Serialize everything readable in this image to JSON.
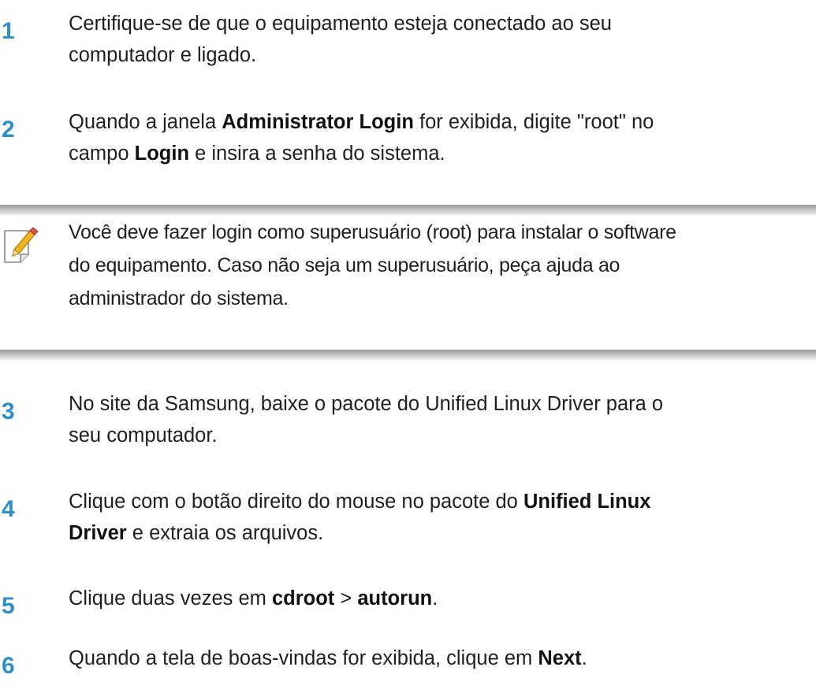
{
  "steps": [
    {
      "number": "1",
      "lines": [
        [
          {
            "text": "Certifique-se de que o equipamento esteja conectado ao seu",
            "bold": false
          }
        ],
        [
          {
            "text": "computador e ligado.",
            "bold": false
          }
        ]
      ]
    },
    {
      "number": "2",
      "lines": [
        [
          {
            "text": "Quando a janela ",
            "bold": false
          },
          {
            "text": "Administrator Login",
            "bold": true
          },
          {
            "text": " for exibida, digite \"root\" no",
            "bold": false
          }
        ],
        [
          {
            "text": "campo ",
            "bold": false
          },
          {
            "text": "Login",
            "bold": true
          },
          {
            "text": " e insira a senha do sistema.",
            "bold": false
          }
        ]
      ]
    },
    {
      "number": "3",
      "lines": [
        [
          {
            "text": "No site da Samsung, baixe o pacote do Unified Linux Driver para o",
            "bold": false
          }
        ],
        [
          {
            "text": "seu computador.",
            "bold": false
          }
        ]
      ]
    },
    {
      "number": "4",
      "lines": [
        [
          {
            "text": "Clique com o botão direito do mouse no pacote do ",
            "bold": false
          },
          {
            "text": "Unified Linux",
            "bold": true
          }
        ],
        [
          {
            "text": "Driver",
            "bold": true
          },
          {
            "text": " e extraia os arquivos.",
            "bold": false
          }
        ]
      ]
    },
    {
      "number": "5",
      "lines": [
        [
          {
            "text": "Clique duas vezes em ",
            "bold": false
          },
          {
            "text": "cdroot",
            "bold": true
          },
          {
            "text": " > ",
            "bold": false
          },
          {
            "text": "autorun",
            "bold": true
          },
          {
            "text": ".",
            "bold": false
          }
        ]
      ]
    },
    {
      "number": "6",
      "lines": [
        [
          {
            "text": "Quando a tela de boas-vindas for exibida, clique em ",
            "bold": false
          },
          {
            "text": "Next",
            "bold": true
          },
          {
            "text": ".",
            "bold": false
          }
        ]
      ]
    }
  ],
  "note": {
    "icon": "note-pencil-icon",
    "lines": [
      "Você deve fazer login como superusuário (root) para instalar o software",
      "do equipamento. Caso não seja um superusuário, peça ajuda ao",
      "administrador do sistema."
    ]
  },
  "colors": {
    "step_number": "#2f8fc9",
    "note_bar": "#b8b8b8",
    "text": "#1f1f1f"
  }
}
